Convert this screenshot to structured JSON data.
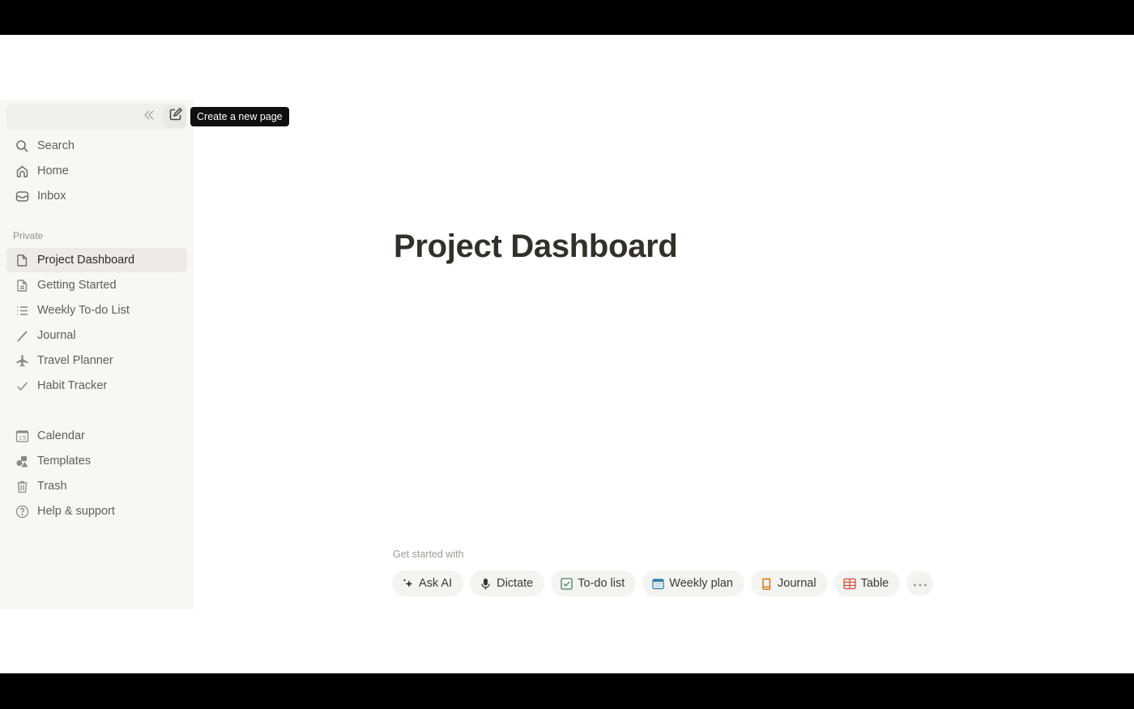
{
  "sidebar": {
    "collapse_icon": "double-chevron-left-icon",
    "new_page_icon": "compose-icon",
    "tooltip": "Create a new page",
    "top_items": [
      {
        "label": "Search",
        "icon": "search-icon"
      },
      {
        "label": "Home",
        "icon": "home-icon"
      },
      {
        "label": "Inbox",
        "icon": "inbox-icon"
      }
    ],
    "section_label": "Private",
    "private_items": [
      {
        "label": "Project Dashboard",
        "icon": "page-icon",
        "active": true
      },
      {
        "label": "Getting Started",
        "icon": "document-icon"
      },
      {
        "label": "Weekly To-do List",
        "icon": "list-icon"
      },
      {
        "label": "Journal",
        "icon": "pencil-icon"
      },
      {
        "label": "Travel Planner",
        "icon": "airplane-icon"
      },
      {
        "label": "Habit Tracker",
        "icon": "checkmark-icon"
      }
    ],
    "bottom_items": [
      {
        "label": "Calendar",
        "icon": "calendar-icon",
        "calendar_day": "19"
      },
      {
        "label": "Templates",
        "icon": "templates-icon"
      },
      {
        "label": "Trash",
        "icon": "trash-icon"
      },
      {
        "label": "Help & support",
        "icon": "help-icon"
      }
    ]
  },
  "main": {
    "title": "Project Dashboard",
    "get_started_label": "Get started with",
    "chips": [
      {
        "label": "Ask AI",
        "icon": "sparkle-icon"
      },
      {
        "label": "Dictate",
        "icon": "microphone-icon"
      },
      {
        "label": "To-do list",
        "icon": "checkbox-icon",
        "color": "#448361"
      },
      {
        "label": "Weekly plan",
        "icon": "calendar-icon",
        "color": "#337ea9"
      },
      {
        "label": "Journal",
        "icon": "book-icon",
        "color": "#d9730d"
      },
      {
        "label": "Table",
        "icon": "table-icon",
        "color": "#d44c47"
      },
      {
        "label": "",
        "icon": "more-icon"
      }
    ]
  }
}
